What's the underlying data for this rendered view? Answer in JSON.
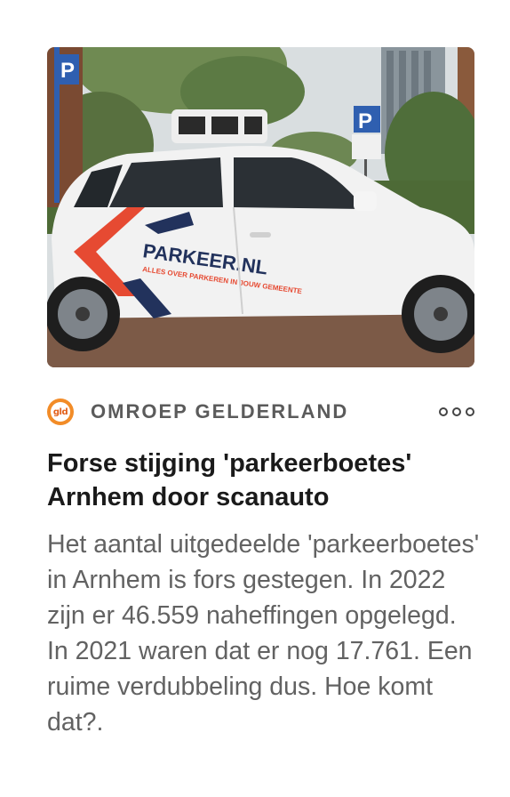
{
  "image": {
    "description": "Photo of a white Renault Zoe scan car with PARKEER.NL livery",
    "brand_text": "PARKEER.NL",
    "tagline": "ALLES OVER PARKEREN IN JOUW GEMEENTE",
    "sign_letter": "P"
  },
  "source": {
    "logo_text": "gld",
    "name": "OMROEP GELDERLAND",
    "logo_color": "#f28c28",
    "more_icon": "more-horizontal-icon"
  },
  "article": {
    "headline": "Forse stijging 'parkeerboetes' Arnhem door scanauto",
    "summary": "Het aantal uitgedeelde 'parkeerboetes' in Arnhem is fors gestegen. In 2022 zijn er 46.559 naheffingen opgelegd. In 2021 waren dat er nog 17.761. Een ruime verdubbeling dus. Hoe komt dat?."
  }
}
